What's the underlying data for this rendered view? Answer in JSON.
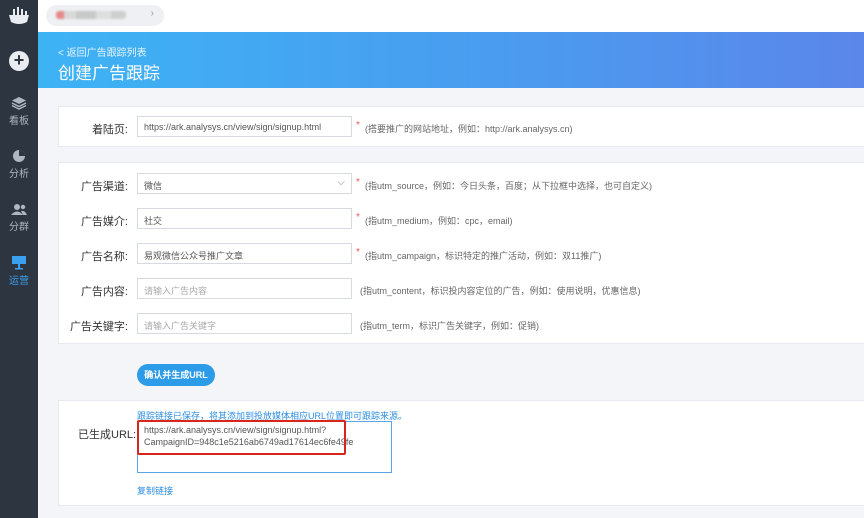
{
  "sidebar": {
    "items": [
      {
        "label": "看板",
        "icon": "layers-icon"
      },
      {
        "label": "分析",
        "icon": "pie-chart-icon"
      },
      {
        "label": "分群",
        "icon": "users-icon"
      },
      {
        "label": "运营",
        "icon": "presentation-icon"
      }
    ],
    "active_color": "#3aa1f0"
  },
  "header": {
    "back_link": "< 返回广告跟踪列表",
    "title": "创建广告跟踪"
  },
  "landing": {
    "label": "着陆页:",
    "value": "https://ark.analysys.cn/view/sign/signup.html",
    "required": "*",
    "hint": "(搭要推广的网站地址，例如：http://ark.analysys.cn)"
  },
  "fields": {
    "source": {
      "label": "广告渠道:",
      "value": "微信",
      "required": "*",
      "hint": "(指utm_source，例如：今日头条，百度；从下拉框中选择，也可自定义)"
    },
    "medium": {
      "label": "广告媒介:",
      "value": "社交",
      "required": "*",
      "hint": "(指utm_medium，例如：cpc，email)"
    },
    "campaign": {
      "label": "广告名称:",
      "value": "易观微信公众号推广文章",
      "required": "*",
      "hint": "(指utm_campaign，标识特定的推广活动，例如：双11推广)"
    },
    "content": {
      "label": "广告内容:",
      "placeholder": "请输入广告内容",
      "hint": "(指utm_content，标识投内容定位的广告，例如：使用说明，优惠信息)"
    },
    "term": {
      "label": "广告关键字:",
      "placeholder": "请输入广告关键字",
      "hint": "(指utm_term，标识广告关键字，例如：促销)"
    }
  },
  "submit_button": "确认并生成URL",
  "result": {
    "saved_message": "跟踪链接已保存，将其添加到投放媒体相应URL位置即可跟踪来源。",
    "label": "已生成URL:",
    "url_line1": "https://ark.analysys.cn/view/sign/signup.html?",
    "url_line2": "CampaignID=948c1e5216ab6749ad17614ec6fe49fe",
    "copy_link": "复制链接"
  }
}
